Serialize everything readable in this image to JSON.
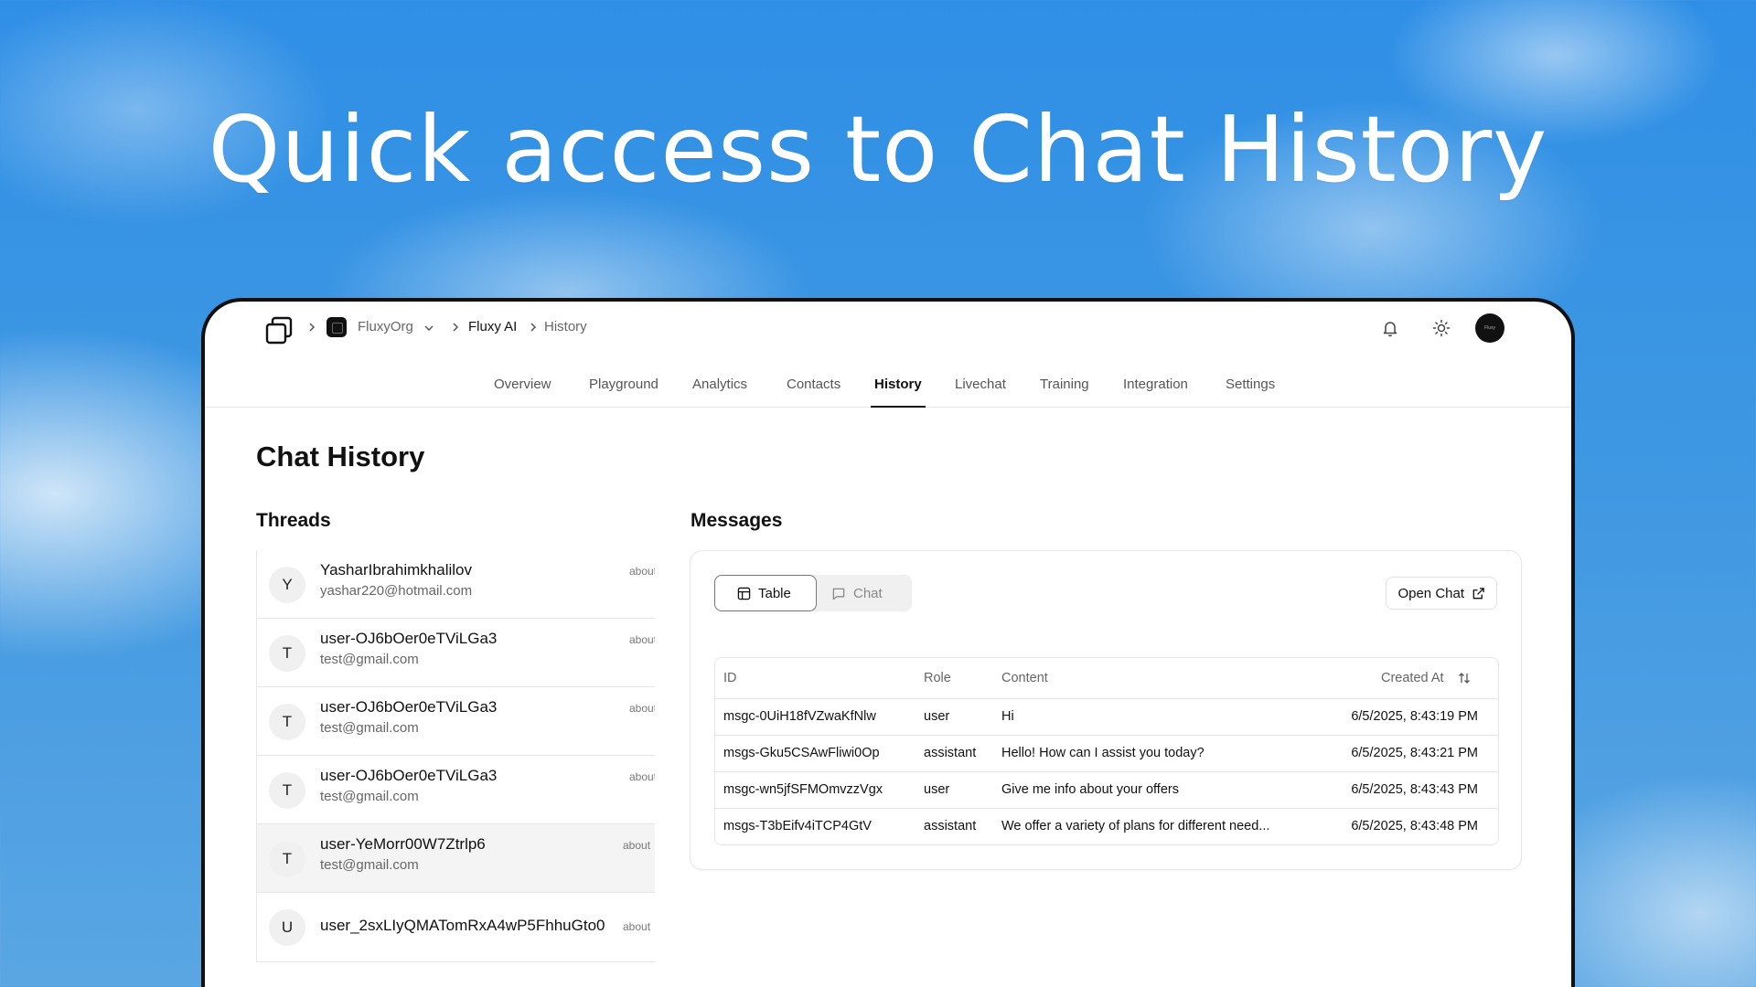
{
  "hero": {
    "title": "Quick access to Chat History"
  },
  "breadcrumb": {
    "org": "FluxyOrg",
    "project": "Fluxy AI",
    "page": "History"
  },
  "header": {
    "avatar_text": "Fluxy"
  },
  "tabs": [
    {
      "label": "Overview"
    },
    {
      "label": "Playground"
    },
    {
      "label": "Analytics"
    },
    {
      "label": "Contacts"
    },
    {
      "label": "History",
      "active": true
    },
    {
      "label": "Livechat"
    },
    {
      "label": "Training"
    },
    {
      "label": "Integration"
    },
    {
      "label": "Settings"
    }
  ],
  "page": {
    "title": "Chat History"
  },
  "threads": {
    "title": "Threads",
    "items": [
      {
        "initial": "Y",
        "name": "YasharIbrahimkhalilov",
        "email": "yashar220@hotmail.com",
        "time": "about"
      },
      {
        "initial": "T",
        "name": "user-OJ6bOer0eTViLGa3",
        "email": "test@gmail.com",
        "time": "about"
      },
      {
        "initial": "T",
        "name": "user-OJ6bOer0eTViLGa3",
        "email": "test@gmail.com",
        "time": "about"
      },
      {
        "initial": "T",
        "name": "user-OJ6bOer0eTViLGa3",
        "email": "test@gmail.com",
        "time": "about"
      },
      {
        "initial": "T",
        "name": "user-YeMorr00W7Ztrlp6",
        "email": "test@gmail.com",
        "time": "about"
      },
      {
        "initial": "U",
        "name": "user_2sxLIyQMATomRxA4wP5FhhuGto0",
        "email": "",
        "time": "about"
      }
    ]
  },
  "messages": {
    "title": "Messages",
    "view_table_label": "Table",
    "view_chat_label": "Chat",
    "open_chat_label": "Open Chat",
    "columns": {
      "id": "ID",
      "role": "Role",
      "content": "Content",
      "created": "Created At"
    },
    "rows": [
      {
        "id": "msgc-0UiH18fVZwaKfNlw",
        "role": "user",
        "content": "Hi",
        "created": "6/5/2025, 8:43:19 PM"
      },
      {
        "id": "msgs-Gku5CSAwFliwi0Op",
        "role": "assistant",
        "content": "Hello! How can I assist you today?",
        "created": "6/5/2025, 8:43:21 PM"
      },
      {
        "id": "msgc-wn5jfSFMOmvzzVgx",
        "role": "user",
        "content": "Give me info about your offers",
        "created": "6/5/2025, 8:43:43 PM"
      },
      {
        "id": "msgs-T3bEifv4iTCP4GtV",
        "role": "assistant",
        "content": "We offer a variety of plans for different need...",
        "created": "6/5/2025, 8:43:48 PM"
      }
    ]
  }
}
